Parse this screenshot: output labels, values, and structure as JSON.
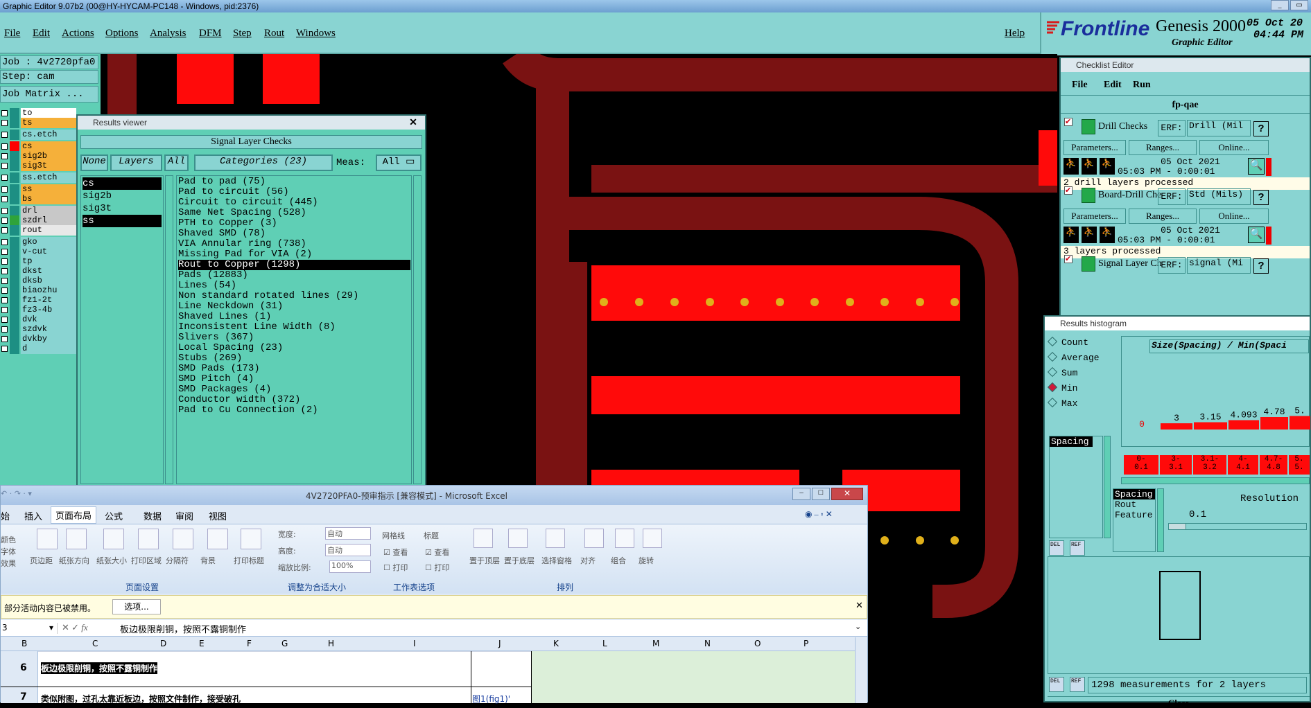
{
  "window": {
    "title": "Graphic Editor 9.07b2 (00@HY-HYCAM-PC148 - Windows, pid:2376)"
  },
  "menu": [
    "File",
    "Edit",
    "Actions",
    "Options",
    "Analysis",
    "DFM",
    "Step",
    "Rout",
    "Windows"
  ],
  "help": "Help",
  "logo": {
    "brand": "Frontline",
    "product": "Genesis 2000",
    "subtitle": "Graphic Editor",
    "date": "05 Oct 20",
    "time": "04:44 PM"
  },
  "job": {
    "job": "Job : 4v2720pfa0",
    "step": "Step: cam",
    "matrix": "Job Matrix ..."
  },
  "layers": [
    {
      "name": "to",
      "color": "#ffffff",
      "sw": "#000000"
    },
    {
      "name": "ts",
      "color": "#f5b03a",
      "sw": "#000000"
    },
    {
      "name": "cs.etch",
      "color": "#89d4d2",
      "sw": "#000000"
    },
    {
      "name": "cs",
      "color": "#f5b03a",
      "sw": "#ff0000"
    },
    {
      "name": "sig2b",
      "color": "#f5b03a",
      "sw": "#000000"
    },
    {
      "name": "sig3t",
      "color": "#f5b03a",
      "sw": "#000000"
    },
    {
      "name": "ss.etch",
      "color": "#89d4d2",
      "sw": "#000000"
    },
    {
      "name": "ss",
      "color": "#f5b03a",
      "sw": "#000000"
    },
    {
      "name": "bs",
      "color": "#f5b03a",
      "sw": "#000000"
    },
    {
      "name": "drl",
      "color": "#c8c8c8",
      "sw": "#000000"
    },
    {
      "name": "szdrl",
      "color": "#c8c8c8",
      "sw": "#2fa33a"
    },
    {
      "name": "rout",
      "color": "#e8e8e8",
      "sw": "#000000"
    },
    {
      "name": "gko",
      "color": "#89d4d2",
      "sw": "#000000"
    },
    {
      "name": "v-cut",
      "color": "#89d4d2",
      "sw": "#000000"
    },
    {
      "name": "tp",
      "color": "#89d4d2",
      "sw": "#000000"
    },
    {
      "name": "dkst",
      "color": "#89d4d2",
      "sw": "#000000"
    },
    {
      "name": "dksb",
      "color": "#89d4d2",
      "sw": "#000000"
    },
    {
      "name": "biaozhu",
      "color": "#89d4d2",
      "sw": "#000000"
    },
    {
      "name": "fz1-2t",
      "color": "#89d4d2",
      "sw": "#000000"
    },
    {
      "name": "fz3-4b",
      "color": "#89d4d2",
      "sw": "#000000"
    },
    {
      "name": "dvk",
      "color": "#89d4d2",
      "sw": "#000000"
    },
    {
      "name": "szdvk",
      "color": "#89d4d2",
      "sw": "#000000"
    },
    {
      "name": "dvkby",
      "color": "#89d4d2",
      "sw": "#000000"
    },
    {
      "name": "d",
      "color": "#89d4d2",
      "sw": "#000000"
    }
  ],
  "results_viewer": {
    "title": "Results viewer",
    "header": "Signal Layer Checks",
    "none": "None",
    "layers": "Layers",
    "all": "All",
    "categories": "Categories (23)",
    "meas_label": "Meas:",
    "meas_value": "All",
    "layer_list": [
      "cs",
      "sig2b",
      "sig3t",
      "ss"
    ],
    "category_list": [
      "Pad to pad (75)",
      "Pad to circuit (56)",
      "Circuit to circuit (445)",
      "Same Net Spacing (528)",
      "PTH to Copper (3)",
      "Shaved SMD (78)",
      "VIA Annular ring (738)",
      "Missing Pad for VIA (2)",
      "Rout to Copper (1298)",
      "Pads (12883)",
      "Lines (54)",
      "Non standard rotated lines (29)",
      "Line Neckdown (31)",
      "Shaved Lines (1)",
      "Inconsistent Line Width (8)",
      "Slivers (367)",
      "Local Spacing (23)",
      "Stubs (269)",
      "SMD Pads (173)",
      "SMD Pitch (4)",
      "SMD Packages (4)",
      "Conductor width (372)",
      "Pad to Cu Connection (2)"
    ],
    "selected": "Rout to Copper (1298)"
  },
  "checklist": {
    "title": "Checklist Editor",
    "menu": [
      "File",
      "Edit",
      "Run"
    ],
    "name": "fp-qae",
    "checks": [
      {
        "name": "Drill Checks",
        "erf": "ERF:",
        "erf_value": "Drill (Mil",
        "date": "05 Oct 2021",
        "time": "05:03 PM - 0:00:01",
        "status": "2 drill layers processed"
      },
      {
        "name": "Board-Drill Che",
        "erf": "ERF:",
        "erf_value": "Std (Mils)",
        "date": "05 Oct 2021",
        "time": "05:03 PM - 0:00:01",
        "status": "3 layers processed"
      },
      {
        "name": "Signal Layer Ch",
        "erf": "ERF:",
        "erf_value": "signal (Mi"
      }
    ],
    "parameters": "Parameters...",
    "ranges": "Ranges...",
    "online": "Online...",
    "q": "?"
  },
  "histogram": {
    "title": "Results histogram",
    "options": [
      "Count",
      "Average",
      "Sum",
      "Min",
      "Max"
    ],
    "selected": "Min",
    "header": "Size(Spacing) / Min(Spaci",
    "bar_labels": [
      "0",
      "3",
      "3.15",
      "4.093",
      "4.78",
      "5."
    ],
    "bar_values": [
      0.0,
      0.3,
      0.35,
      0.45,
      0.6,
      0.65
    ],
    "bin_labels": [
      "0-\n0.1",
      "3-\n3.1",
      "3.1-\n3.2",
      "4-\n4.1",
      "4.7-\n4.8",
      "5.\n5."
    ],
    "attr_list": [
      "Spacing"
    ],
    "feature_list": [
      "Spacing",
      "Rout",
      "Feature"
    ],
    "resolution_label": "Resolution",
    "resolution_value": "0.1",
    "status": "1298 measurements for 2 layers",
    "del": "DEL",
    "ref": "REF",
    "close": "Close"
  },
  "excel": {
    "title": "4V2720PFA0-预审指示 [兼容模式] - Microsoft Excel",
    "tabs": [
      "始",
      "插入",
      "页面布局",
      "公式",
      "数据",
      "审阅",
      "视图"
    ],
    "active_tab": "页面布局",
    "groups": [
      "页面设置",
      "调整为合适大小",
      "工作表选项",
      "排列"
    ],
    "buttons": [
      "页边距",
      "纸张方向",
      "纸张大小",
      "打印区域",
      "分隔符",
      "背景",
      "打印标题",
      "置于顶层",
      "置于底层",
      "选择窗格",
      "对齐",
      "组合",
      "旋转"
    ],
    "left_labels": [
      "颜色",
      "字体",
      "效果"
    ],
    "width_label": "宽度:",
    "height_label": "高度:",
    "scale_label": "缩放比例:",
    "auto": "自动",
    "scale_value": "100%",
    "gridlines": "网格线",
    "headings": "标题",
    "view": "查看",
    "print": "打印",
    "security": "部分活动内容已被禁用。",
    "options_btn": "选项...",
    "name_box": "3",
    "formula": "板边极限削铜，按照不露铜制作",
    "cols": [
      "B",
      "C",
      "D",
      "E",
      "F",
      "G",
      "H",
      "I",
      "J",
      "K",
      "L",
      "M",
      "N",
      "O",
      "P"
    ],
    "rows": [
      {
        "num": "6",
        "text": "板边极限削铜，按照不露铜制作"
      },
      {
        "num": "7",
        "text": "类似附图，过孔太靠近板边，按照文件制作，接受破孔",
        "j": "图1(fig1)'"
      }
    ]
  }
}
